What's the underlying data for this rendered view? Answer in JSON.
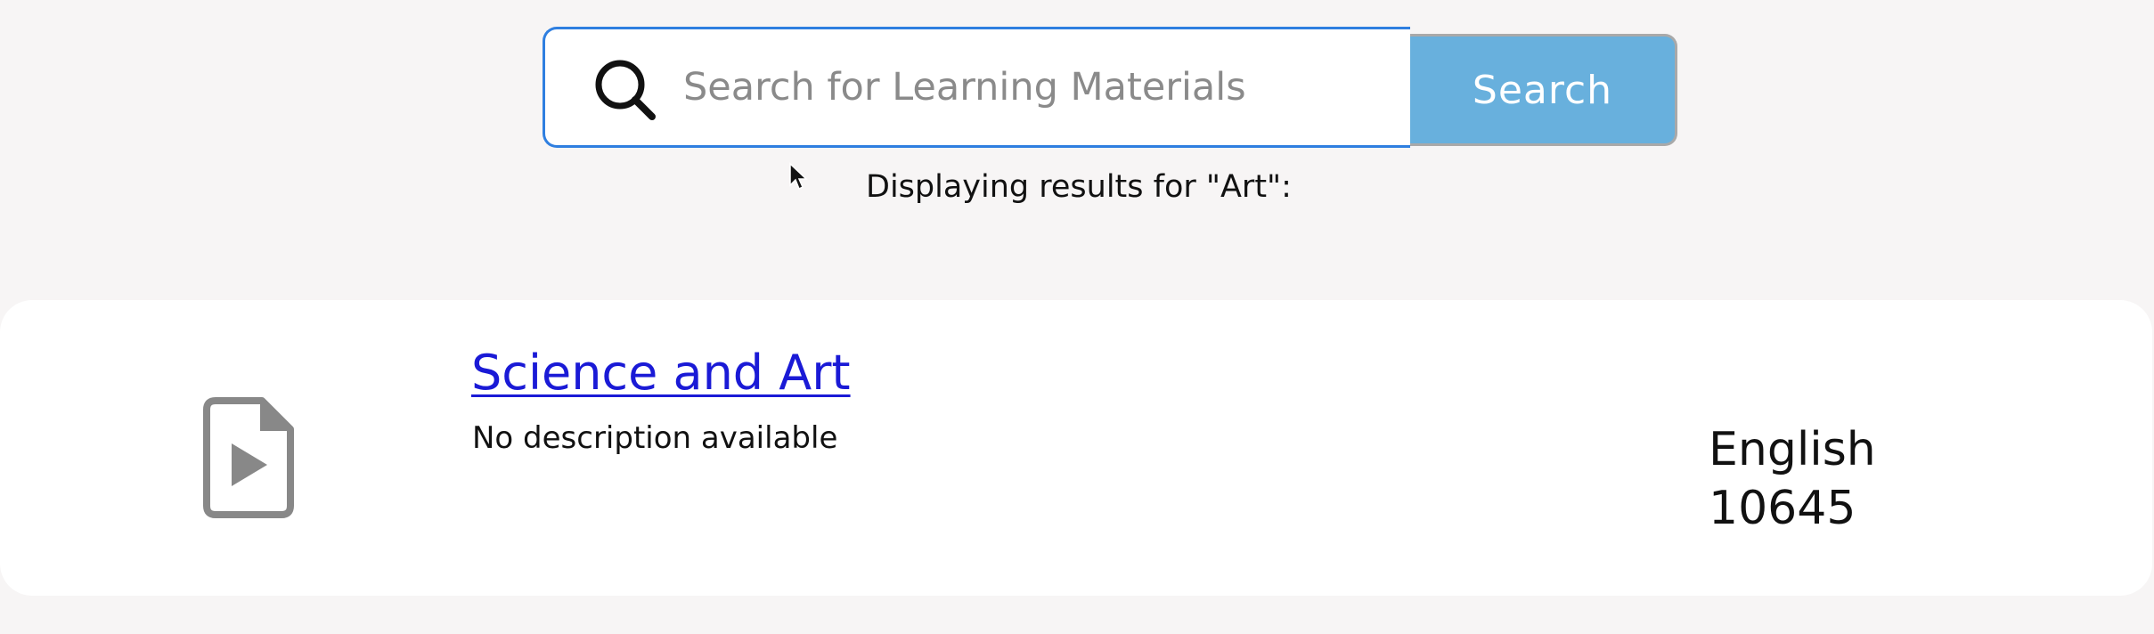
{
  "search": {
    "placeholder": "Search for Learning Materials",
    "value": "",
    "button_label": "Search",
    "icon": "search-icon"
  },
  "results_caption": "Displaying results for \"Art\":",
  "results": [
    {
      "title": "Science and Art",
      "description": "No description available",
      "language": "English",
      "id": "10645",
      "icon": "video-file-icon"
    }
  ],
  "colors": {
    "page_background": "#f7f5f5",
    "search_border": "#2f7fe0",
    "search_button": "#68b0dd",
    "link": "#1a1ad6",
    "file_icon": "#888888"
  }
}
